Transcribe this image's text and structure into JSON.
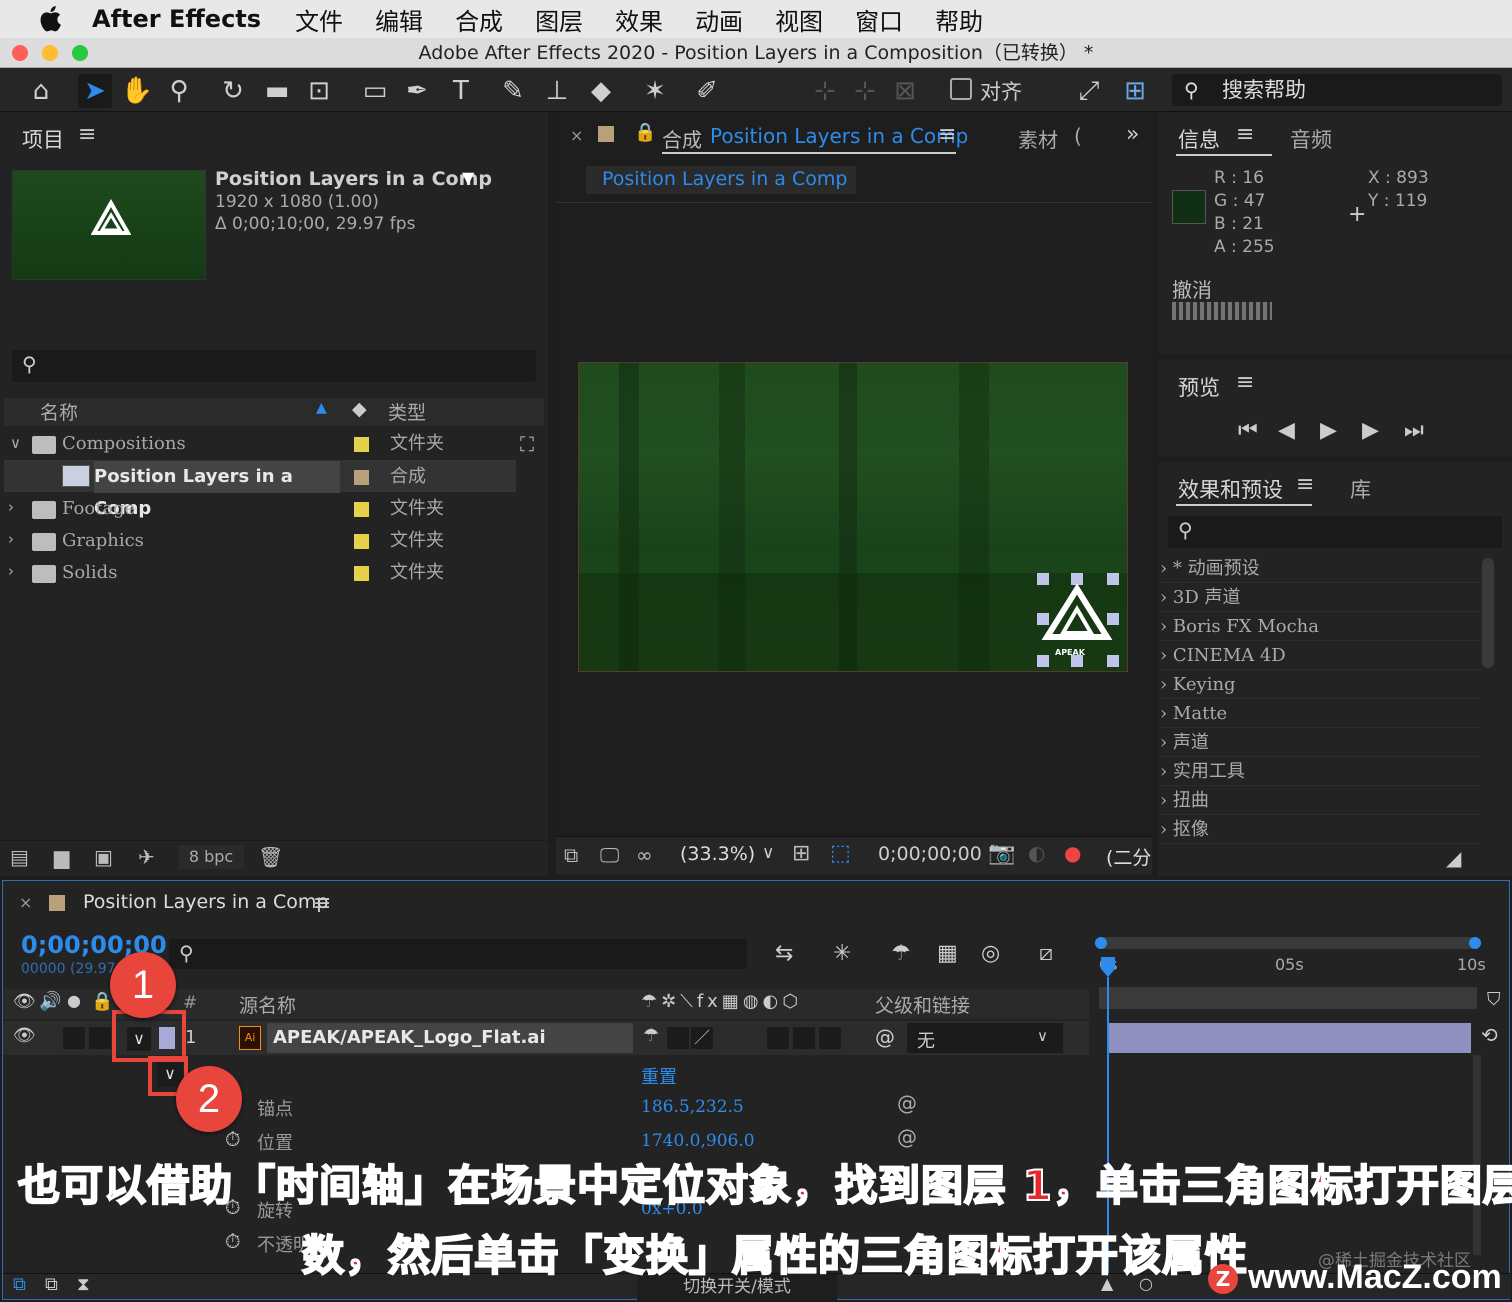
{
  "menubar": {
    "app_name": "After Effects",
    "items": [
      "文件",
      "编辑",
      "合成",
      "图层",
      "效果",
      "动画",
      "视图",
      "窗口",
      "帮助"
    ]
  },
  "window": {
    "title": "Adobe After Effects 2020 - Position Layers in a Composition（已转换） *"
  },
  "toolbar": {
    "align_label": "对齐",
    "search_help_label": "搜索帮助"
  },
  "project_panel": {
    "title": "项目",
    "comp_name": "Position Layers in a Comp",
    "comp_dims": "1920 x 1080 (1.00)",
    "comp_duration": "Δ 0;00;10;00, 29.97 fps",
    "col_name": "名称",
    "col_type": "类型",
    "items": [
      {
        "name": "Compositions",
        "type": "文件夹"
      },
      {
        "name": "Position Layers in a Comp",
        "type": "合成"
      },
      {
        "name": "Footage",
        "type": "文件夹"
      },
      {
        "name": "Graphics",
        "type": "文件夹"
      },
      {
        "name": "Solids",
        "type": "文件夹"
      }
    ],
    "bpc": "8 bpc"
  },
  "comp_panel": {
    "tab_prefix": "合成",
    "tab_name": "Position Layers in a Comp",
    "footage_tab": "素材",
    "footage_paren": "(",
    "sub_tab": "Position Layers in a Comp",
    "zoom": "(33.3%)",
    "timecode": "0;00;00;00",
    "view_partial": "(二分"
  },
  "info_panel": {
    "tab_info": "信息",
    "tab_audio": "音频",
    "r": "R :  16",
    "g": "G :  47",
    "b": "B :  21",
    "a": "A :  255",
    "x": "X : 893",
    "y": "Y : 119",
    "swatch_color": "#102f15",
    "undo_label": "撤消"
  },
  "preview_panel": {
    "title": "预览"
  },
  "effects_panel": {
    "tab_effects": "效果和预设",
    "tab_library": "库",
    "items": [
      "* 动画预设",
      "3D 声道",
      "Boris FX Mocha",
      "CINEMA 4D",
      "Keying",
      "Matte",
      "声道",
      "实用工具",
      "扭曲",
      "抠像"
    ]
  },
  "timeline": {
    "tab_name": "Position Layers in a Comp",
    "timecode": "0;00;00;00",
    "frames": "00000 (29.97",
    "col_hash": "#",
    "col_source": "源名称",
    "col_parent": "父级和链接",
    "layer_number": "1",
    "layer_name": "APEAK/APEAK_Logo_Flat.ai",
    "parent_value": "无",
    "reset_label": "重置",
    "properties": [
      {
        "name": "锚点",
        "value": "186.5,232.5"
      },
      {
        "name": "位置",
        "value": "1740.0,906.0"
      },
      {
        "name": "旋转",
        "value": "0x+0.0"
      },
      {
        "name": "不透明",
        "value": ""
      }
    ],
    "ruler": [
      "0s",
      "05s",
      "10s"
    ],
    "switch_mode_label": "切换开关/模式"
  },
  "annotations": {
    "badge_1": "1",
    "badge_2": "2",
    "caption_line1": "也可以借助「时间轴」在场景中定位对象，找到图层 1，单击三角图标打开图层参",
    "caption_line2": "数，然后单击「变换」属性的三角图标打开该属性",
    "watermark_small": "@稀土掘金技术社区",
    "watermark_site": "www.MacZ.com"
  },
  "colors": {
    "accent_blue": "#2d8ceb",
    "annotation_red": "#e8453c",
    "caption_red": "#e8262b",
    "label_yellow": "#e6d14a"
  }
}
